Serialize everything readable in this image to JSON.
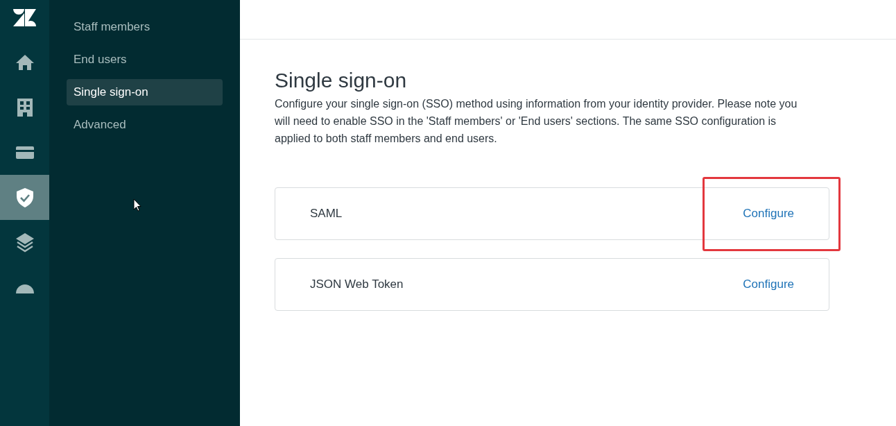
{
  "rail": {
    "items": [
      {
        "kind": "home",
        "selected": false
      },
      {
        "kind": "building",
        "selected": false
      },
      {
        "kind": "card",
        "selected": false
      },
      {
        "kind": "shield",
        "selected": true
      },
      {
        "kind": "layers",
        "selected": false
      },
      {
        "kind": "dome",
        "selected": false
      }
    ]
  },
  "nav": {
    "items": [
      {
        "label": "Staff members",
        "selected": false
      },
      {
        "label": "End users",
        "selected": false
      },
      {
        "label": "Single sign-on",
        "selected": true
      },
      {
        "label": "Advanced",
        "selected": false
      }
    ]
  },
  "page": {
    "title": "Single sign-on",
    "description": "Configure your single sign-on (SSO) method using information from your identity provider. Please note you will need to enable SSO in the 'Staff members' or 'End users' sections. The same SSO configuration is applied to both staff members and end users."
  },
  "methods": [
    {
      "name": "SAML",
      "action": "Configure",
      "highlighted": true
    },
    {
      "name": "JSON Web Token",
      "action": "Configure",
      "highlighted": false
    }
  ]
}
